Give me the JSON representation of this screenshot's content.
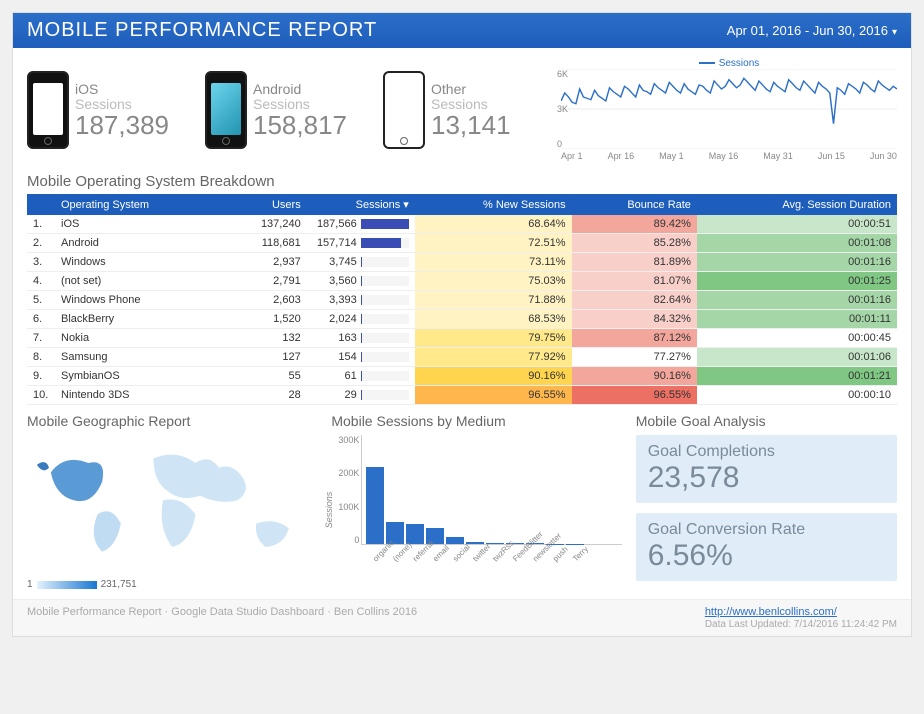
{
  "header": {
    "title": "MOBILE PERFORMANCE REPORT",
    "date_range": "Apr 01, 2016 - Jun 30, 2016"
  },
  "devices": {
    "ios": {
      "label": "iOS",
      "sub": "Sessions",
      "value": "187,389"
    },
    "android": {
      "label": "Android",
      "sub": "Sessions",
      "value": "158,817"
    },
    "other": {
      "label": "Other",
      "sub": "Sessions",
      "value": "13,141"
    }
  },
  "sparkline": {
    "legend": "Sessions",
    "yticks": [
      "6K",
      "3K",
      "0"
    ],
    "xticks": [
      "Apr 1",
      "Apr 16",
      "May 1",
      "May 16",
      "May 31",
      "Jun 15",
      "Jun 30"
    ]
  },
  "table": {
    "title": "Mobile Operating System Breakdown",
    "columns": [
      "",
      "Operating System",
      "Users",
      "Sessions ▾",
      "% New Sessions",
      "Bounce Rate",
      "Avg. Session Duration"
    ],
    "rows": [
      {
        "n": "1.",
        "os": "iOS",
        "users": "137,240",
        "sessions": "187,566",
        "bar": 100,
        "new": "68.64%",
        "bounce": "89.42%",
        "dur": "00:00:51",
        "hNew": "heat-yellow",
        "hBounce": "heat-red-m",
        "hDur": "heat-green-l"
      },
      {
        "n": "2.",
        "os": "Android",
        "users": "118,681",
        "sessions": "157,714",
        "bar": 84,
        "new": "72.51%",
        "bounce": "85.28%",
        "dur": "00:01:08",
        "hNew": "heat-yellow",
        "hBounce": "heat-red-l",
        "hDur": "heat-green-m"
      },
      {
        "n": "3.",
        "os": "Windows",
        "users": "2,937",
        "sessions": "3,745",
        "bar": 2,
        "new": "73.11%",
        "bounce": "81.89%",
        "dur": "00:01:16",
        "hNew": "heat-yellow",
        "hBounce": "heat-red-l",
        "hDur": "heat-green-m"
      },
      {
        "n": "4.",
        "os": "(not set)",
        "users": "2,791",
        "sessions": "3,560",
        "bar": 2,
        "new": "75.03%",
        "bounce": "81.07%",
        "dur": "00:01:25",
        "hNew": "heat-yellow",
        "hBounce": "heat-red-l",
        "hDur": "heat-green-d"
      },
      {
        "n": "5.",
        "os": "Windows Phone",
        "users": "2,603",
        "sessions": "3,393",
        "bar": 2,
        "new": "71.88%",
        "bounce": "82.64%",
        "dur": "00:01:16",
        "hNew": "heat-yellow",
        "hBounce": "heat-red-l",
        "hDur": "heat-green-m"
      },
      {
        "n": "6.",
        "os": "BlackBerry",
        "users": "1,520",
        "sessions": "2,024",
        "bar": 1,
        "new": "68.53%",
        "bounce": "84.32%",
        "dur": "00:01:11",
        "hNew": "heat-yellow",
        "hBounce": "heat-red-l",
        "hDur": "heat-green-m"
      },
      {
        "n": "7.",
        "os": "Nokia",
        "users": "132",
        "sessions": "163",
        "bar": 0.5,
        "new": "79.75%",
        "bounce": "87.12%",
        "dur": "00:00:45",
        "hNew": "heat-yellow-2",
        "hBounce": "heat-red-m",
        "hDur": "heat-none"
      },
      {
        "n": "8.",
        "os": "Samsung",
        "users": "127",
        "sessions": "154",
        "bar": 0.5,
        "new": "77.92%",
        "bounce": "77.27%",
        "dur": "00:01:06",
        "hNew": "heat-yellow-2",
        "hBounce": "heat-none",
        "hDur": "heat-green-l"
      },
      {
        "n": "9.",
        "os": "SymbianOS",
        "users": "55",
        "sessions": "61",
        "bar": 0.3,
        "new": "90.16%",
        "bounce": "90.16%",
        "dur": "00:01:21",
        "hNew": "heat-yellow-3",
        "hBounce": "heat-red-m",
        "hDur": "heat-green-d"
      },
      {
        "n": "10.",
        "os": "Nintendo 3DS",
        "users": "28",
        "sessions": "29",
        "bar": 0.2,
        "new": "96.55%",
        "bounce": "96.55%",
        "dur": "00:00:10",
        "hNew": "heat-orange",
        "hBounce": "heat-red-d",
        "hDur": "heat-none"
      }
    ]
  },
  "geo": {
    "title": "Mobile Geographic Report",
    "min": "1",
    "max": "231,751"
  },
  "medium_chart": {
    "title": "Mobile Sessions by Medium",
    "ylabel": "Sessions",
    "yticks": [
      "300K",
      "200K",
      "100K",
      "0"
    ]
  },
  "goals": {
    "title": "Mobile Goal Analysis",
    "completions": {
      "label": "Goal Completions",
      "value": "23,578"
    },
    "conversion": {
      "label": "Goal Conversion Rate",
      "value": "6.56%"
    }
  },
  "footer": {
    "credit": "Mobile Performance Report · Google Data Studio Dashboard · Ben Collins 2016",
    "link": "http://www.benlcollins.com/",
    "updated": "Data Last Updated: 7/14/2016 11:24:42 PM"
  },
  "chart_data": [
    {
      "type": "line",
      "title": "Sessions",
      "xlabel": "",
      "ylabel": "Sessions",
      "ylim": [
        0,
        6000
      ],
      "x_range": [
        "Apr 1",
        "Jun 30"
      ],
      "series": [
        {
          "name": "Sessions",
          "values": [
            3600,
            4200,
            3900,
            3500,
            3400,
            4500,
            3900,
            3800,
            3700,
            4400,
            4000,
            3800,
            3600,
            4600,
            4300,
            4100,
            3900,
            4700,
            4500,
            4200,
            3900,
            4800,
            4400,
            4300,
            4100,
            4900,
            4600,
            4400,
            4200,
            5000,
            4700,
            4400,
            4200,
            4900,
            4500,
            4300,
            4100,
            4800,
            4700,
            4400,
            4200,
            5100,
            4800,
            4500,
            4700,
            5200,
            4900,
            4600,
            4800,
            5300,
            5000,
            4700,
            4400,
            5100,
            4800,
            4500,
            4300,
            5000,
            4700,
            4500,
            4300,
            5200,
            4900,
            4600,
            4400,
            5100,
            4800,
            4500,
            4200,
            5000,
            4700,
            4500,
            4200,
            1900,
            4600,
            4400,
            4100,
            4900,
            4700,
            4500,
            4200,
            5000,
            4800,
            4500,
            4300,
            5100,
            4800,
            4600,
            4400,
            4700,
            4500
          ]
        }
      ]
    },
    {
      "type": "bar",
      "title": "Mobile Sessions by Medium",
      "ylabel": "Sessions",
      "ylim": [
        0,
        300000
      ],
      "categories": [
        "organic",
        "(none)",
        "referral",
        "email",
        "social",
        "twitter",
        "twzRss",
        "FeedBlitter",
        "newsletter",
        "push",
        "Terry"
      ],
      "values": [
        210000,
        60000,
        55000,
        45000,
        18000,
        6000,
        3000,
        2000,
        1500,
        1000,
        500
      ]
    },
    {
      "type": "table",
      "title": "Mobile Operating System Breakdown",
      "columns": [
        "Operating System",
        "Users",
        "Sessions",
        "% New Sessions",
        "Bounce Rate",
        "Avg. Session Duration"
      ],
      "rows": [
        [
          "iOS",
          137240,
          187566,
          68.64,
          89.42,
          "00:00:51"
        ],
        [
          "Android",
          118681,
          157714,
          72.51,
          85.28,
          "00:01:08"
        ],
        [
          "Windows",
          2937,
          3745,
          73.11,
          81.89,
          "00:01:16"
        ],
        [
          "(not set)",
          2791,
          3560,
          75.03,
          81.07,
          "00:01:25"
        ],
        [
          "Windows Phone",
          2603,
          3393,
          71.88,
          82.64,
          "00:01:16"
        ],
        [
          "BlackBerry",
          1520,
          2024,
          68.53,
          84.32,
          "00:01:11"
        ],
        [
          "Nokia",
          132,
          163,
          79.75,
          87.12,
          "00:00:45"
        ],
        [
          "Samsung",
          127,
          154,
          77.92,
          77.27,
          "00:01:06"
        ],
        [
          "SymbianOS",
          55,
          61,
          90.16,
          90.16,
          "00:01:21"
        ],
        [
          "Nintendo 3DS",
          28,
          29,
          96.55,
          96.55,
          "00:00:10"
        ]
      ]
    }
  ]
}
